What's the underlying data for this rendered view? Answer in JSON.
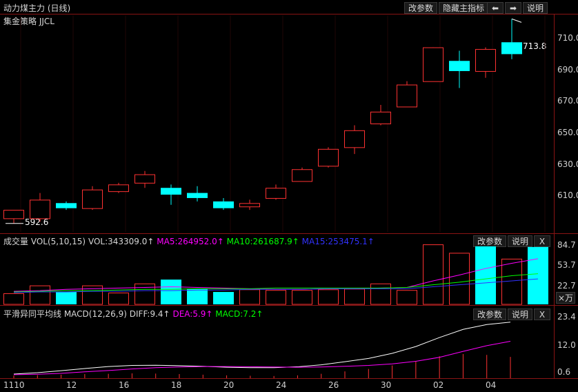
{
  "window": {
    "title": "动力煤主力 (日线)",
    "subtitle": "集金策略 JJCL",
    "buttons": [
      "改参数",
      "隐藏主指标",
      "⬅",
      "➡",
      "说明"
    ]
  },
  "colors": {
    "up": "#ff3232",
    "down": "#00ffff",
    "ma5": "#ff00ff",
    "ma10": "#00ff00",
    "ma15": "#3232ff",
    "diff": "#ffffff",
    "dea": "#ff00ff",
    "grid": "#8a1414"
  },
  "price": {
    "low_label": "592.6",
    "high_label": "713.8",
    "yticks": [
      "710.0",
      "690.0",
      "670.0",
      "650.0",
      "630.0",
      "610.0"
    ]
  },
  "volume": {
    "title": "成交量 VOL(5,10,15)",
    "vol": "VOL:343309.0↑",
    "ma5": "MA5:264952.0↑",
    "ma10": "MA10:261687.9↑",
    "ma15": "MA15:253475.1↑",
    "buttons": [
      "改参数",
      "说明",
      "X"
    ],
    "yticks": [
      "84.7",
      "53.7",
      "22.7"
    ],
    "unit": "×万"
  },
  "macd": {
    "title": "平滑异同平均线 MACD(12,26,9)",
    "diff": "DIFF:9.4↑",
    "dea": "DEA:5.9↑",
    "macd": "MACD:7.2↑",
    "buttons": [
      "改参数",
      "说明",
      "X"
    ],
    "yticks": [
      "23.4",
      "12.0",
      "0.6"
    ]
  },
  "xaxis": [
    "1110",
    "12",
    "16",
    "18",
    "20",
    "24",
    "26",
    "30",
    "02",
    "04"
  ],
  "chart_data": [
    {
      "type": "candlestick",
      "title": "动力煤主力 (日线)",
      "ylim": [
        588,
        716
      ],
      "ohlc": [
        {
          "o": 596,
          "h": 600,
          "l": 593,
          "c": 601
        },
        {
          "o": 596,
          "h": 611,
          "l": 594,
          "c": 607
        },
        {
          "o": 605,
          "h": 606,
          "l": 601,
          "c": 602
        },
        {
          "o": 602,
          "h": 615,
          "l": 601,
          "c": 613
        },
        {
          "o": 612,
          "h": 617,
          "l": 611,
          "c": 616
        },
        {
          "o": 617,
          "h": 624,
          "l": 614,
          "c": 622
        },
        {
          "o": 614,
          "h": 616,
          "l": 604,
          "c": 610
        },
        {
          "o": 611,
          "h": 615,
          "l": 606,
          "c": 608
        },
        {
          "o": 606,
          "h": 608,
          "l": 601,
          "c": 602
        },
        {
          "o": 603,
          "h": 607,
          "l": 601,
          "c": 605
        },
        {
          "o": 608,
          "h": 616,
          "l": 607,
          "c": 614
        },
        {
          "o": 618,
          "h": 626,
          "l": 618,
          "c": 625
        },
        {
          "o": 627,
          "h": 638,
          "l": 626,
          "c": 637
        },
        {
          "o": 638,
          "h": 651,
          "l": 634,
          "c": 648
        },
        {
          "o": 652,
          "h": 663,
          "l": 651,
          "c": 659
        },
        {
          "o": 662,
          "h": 677,
          "l": 662,
          "c": 675
        },
        {
          "o": 677,
          "h": 697,
          "l": 677,
          "c": 697
        },
        {
          "o": 689,
          "h": 695,
          "l": 673,
          "c": 683
        },
        {
          "o": 683,
          "h": 697,
          "l": 679,
          "c": 696
        },
        {
          "o": 700,
          "h": 713.8,
          "l": 690,
          "c": 693
        }
      ]
    },
    {
      "type": "bar",
      "title": "成交量 VOL(5,10,15)",
      "unit": "×万",
      "ylim": [
        0,
        90
      ],
      "values": [
        17,
        29,
        19,
        29,
        18,
        32,
        38,
        24,
        19,
        23,
        22,
        22,
        23,
        24,
        32,
        22,
        92,
        79,
        89,
        70,
        88
      ],
      "direction": [
        "up",
        "up",
        "down",
        "up",
        "up",
        "up",
        "down",
        "down",
        "down",
        "up",
        "up",
        "up",
        "up",
        "up",
        "up",
        "up",
        "up",
        "up",
        "down",
        "up",
        "down"
      ],
      "series": [
        {
          "name": "MA5",
          "values": [
            20,
            21,
            23,
            24,
            25,
            26,
            27,
            26,
            25,
            24,
            23,
            23,
            24,
            24,
            25,
            26,
            36,
            45,
            55,
            63,
            70
          ]
        },
        {
          "name": "MA10",
          "values": [
            19,
            20,
            21,
            21,
            22,
            23,
            23,
            24,
            24,
            24,
            25,
            25,
            25,
            25,
            25,
            26,
            30,
            34,
            39,
            44,
            47
          ]
        },
        {
          "name": "MA15",
          "values": [
            18,
            19,
            19,
            20,
            20,
            21,
            21,
            22,
            22,
            23,
            23,
            23,
            24,
            24,
            24,
            24,
            27,
            30,
            33,
            36,
            39
          ]
        }
      ]
    },
    {
      "type": "line",
      "title": "平滑异同平均线 MACD(12,26,9)",
      "ylim": [
        -1,
        26
      ],
      "series": [
        {
          "name": "DIFF",
          "values": [
            0.9,
            1.5,
            2.4,
            3.4,
            4.3,
            4.8,
            4.9,
            4.7,
            4.4,
            4.0,
            3.8,
            3.8,
            4.2,
            5.1,
            6.5,
            8.0,
            10.3,
            13.4,
            17.5,
            21.2,
            23.4,
            24.5
          ]
        },
        {
          "name": "DEA",
          "values": [
            0.6,
            0.8,
            1.2,
            1.9,
            2.5,
            3.2,
            3.8,
            4.1,
            4.3,
            4.3,
            4.2,
            4.1,
            4.0,
            4.1,
            4.4,
            4.8,
            5.5,
            6.7,
            8.5,
            11.2,
            13.8,
            15.8
          ]
        },
        {
          "name": "MACD",
          "values": [
            0.2,
            0.4,
            0.6,
            0.9,
            1.0,
            1.2,
            1.1,
            0.9,
            0.6,
            0.3,
            0.1,
            0.0,
            0.3,
            1.0,
            2.1,
            3.2,
            4.8,
            6.7,
            9.0,
            10.0,
            9.6,
            8.7
          ]
        }
      ]
    }
  ]
}
